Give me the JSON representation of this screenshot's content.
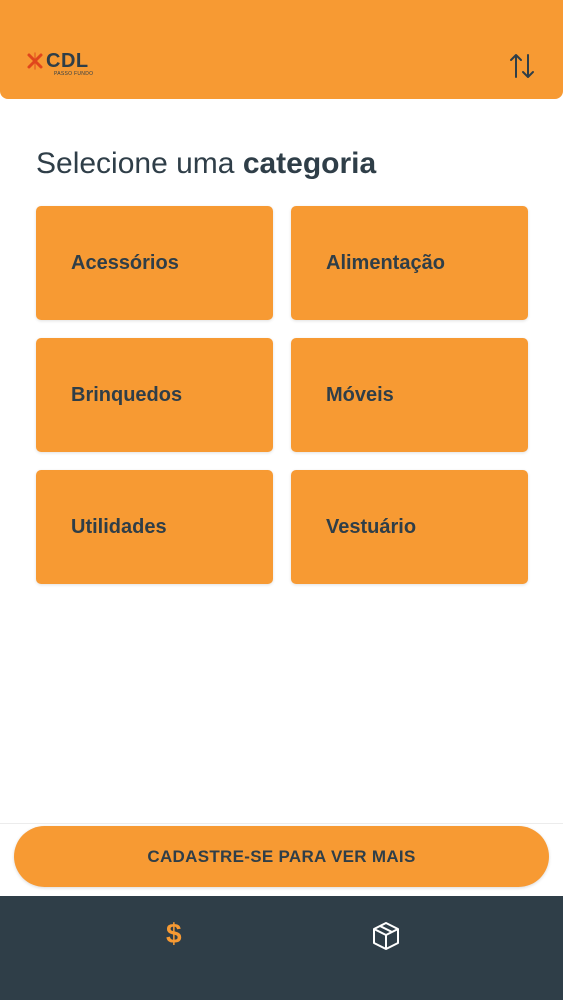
{
  "header": {
    "logo_text": "CDL",
    "logo_subtext": "PASSO FUNDO",
    "sort_icon": "sort-arrows-icon",
    "accent_color": "#f79a33"
  },
  "main": {
    "title_light": "Selecione uma",
    "title_bold": "categoria",
    "categories": [
      {
        "label": "Acessórios"
      },
      {
        "label": "Alimentação"
      },
      {
        "label": "Brinquedos"
      },
      {
        "label": "Móveis"
      },
      {
        "label": "Utilidades"
      },
      {
        "label": "Vestuário"
      }
    ]
  },
  "cta": {
    "label": "CADASTRE-SE PARA VER MAIS"
  },
  "bottom_nav": {
    "background_color": "#2f3e48",
    "items": [
      {
        "icon": "dollar-icon",
        "glyph": "$",
        "active": true
      },
      {
        "icon": "box-icon",
        "active": false
      }
    ]
  }
}
